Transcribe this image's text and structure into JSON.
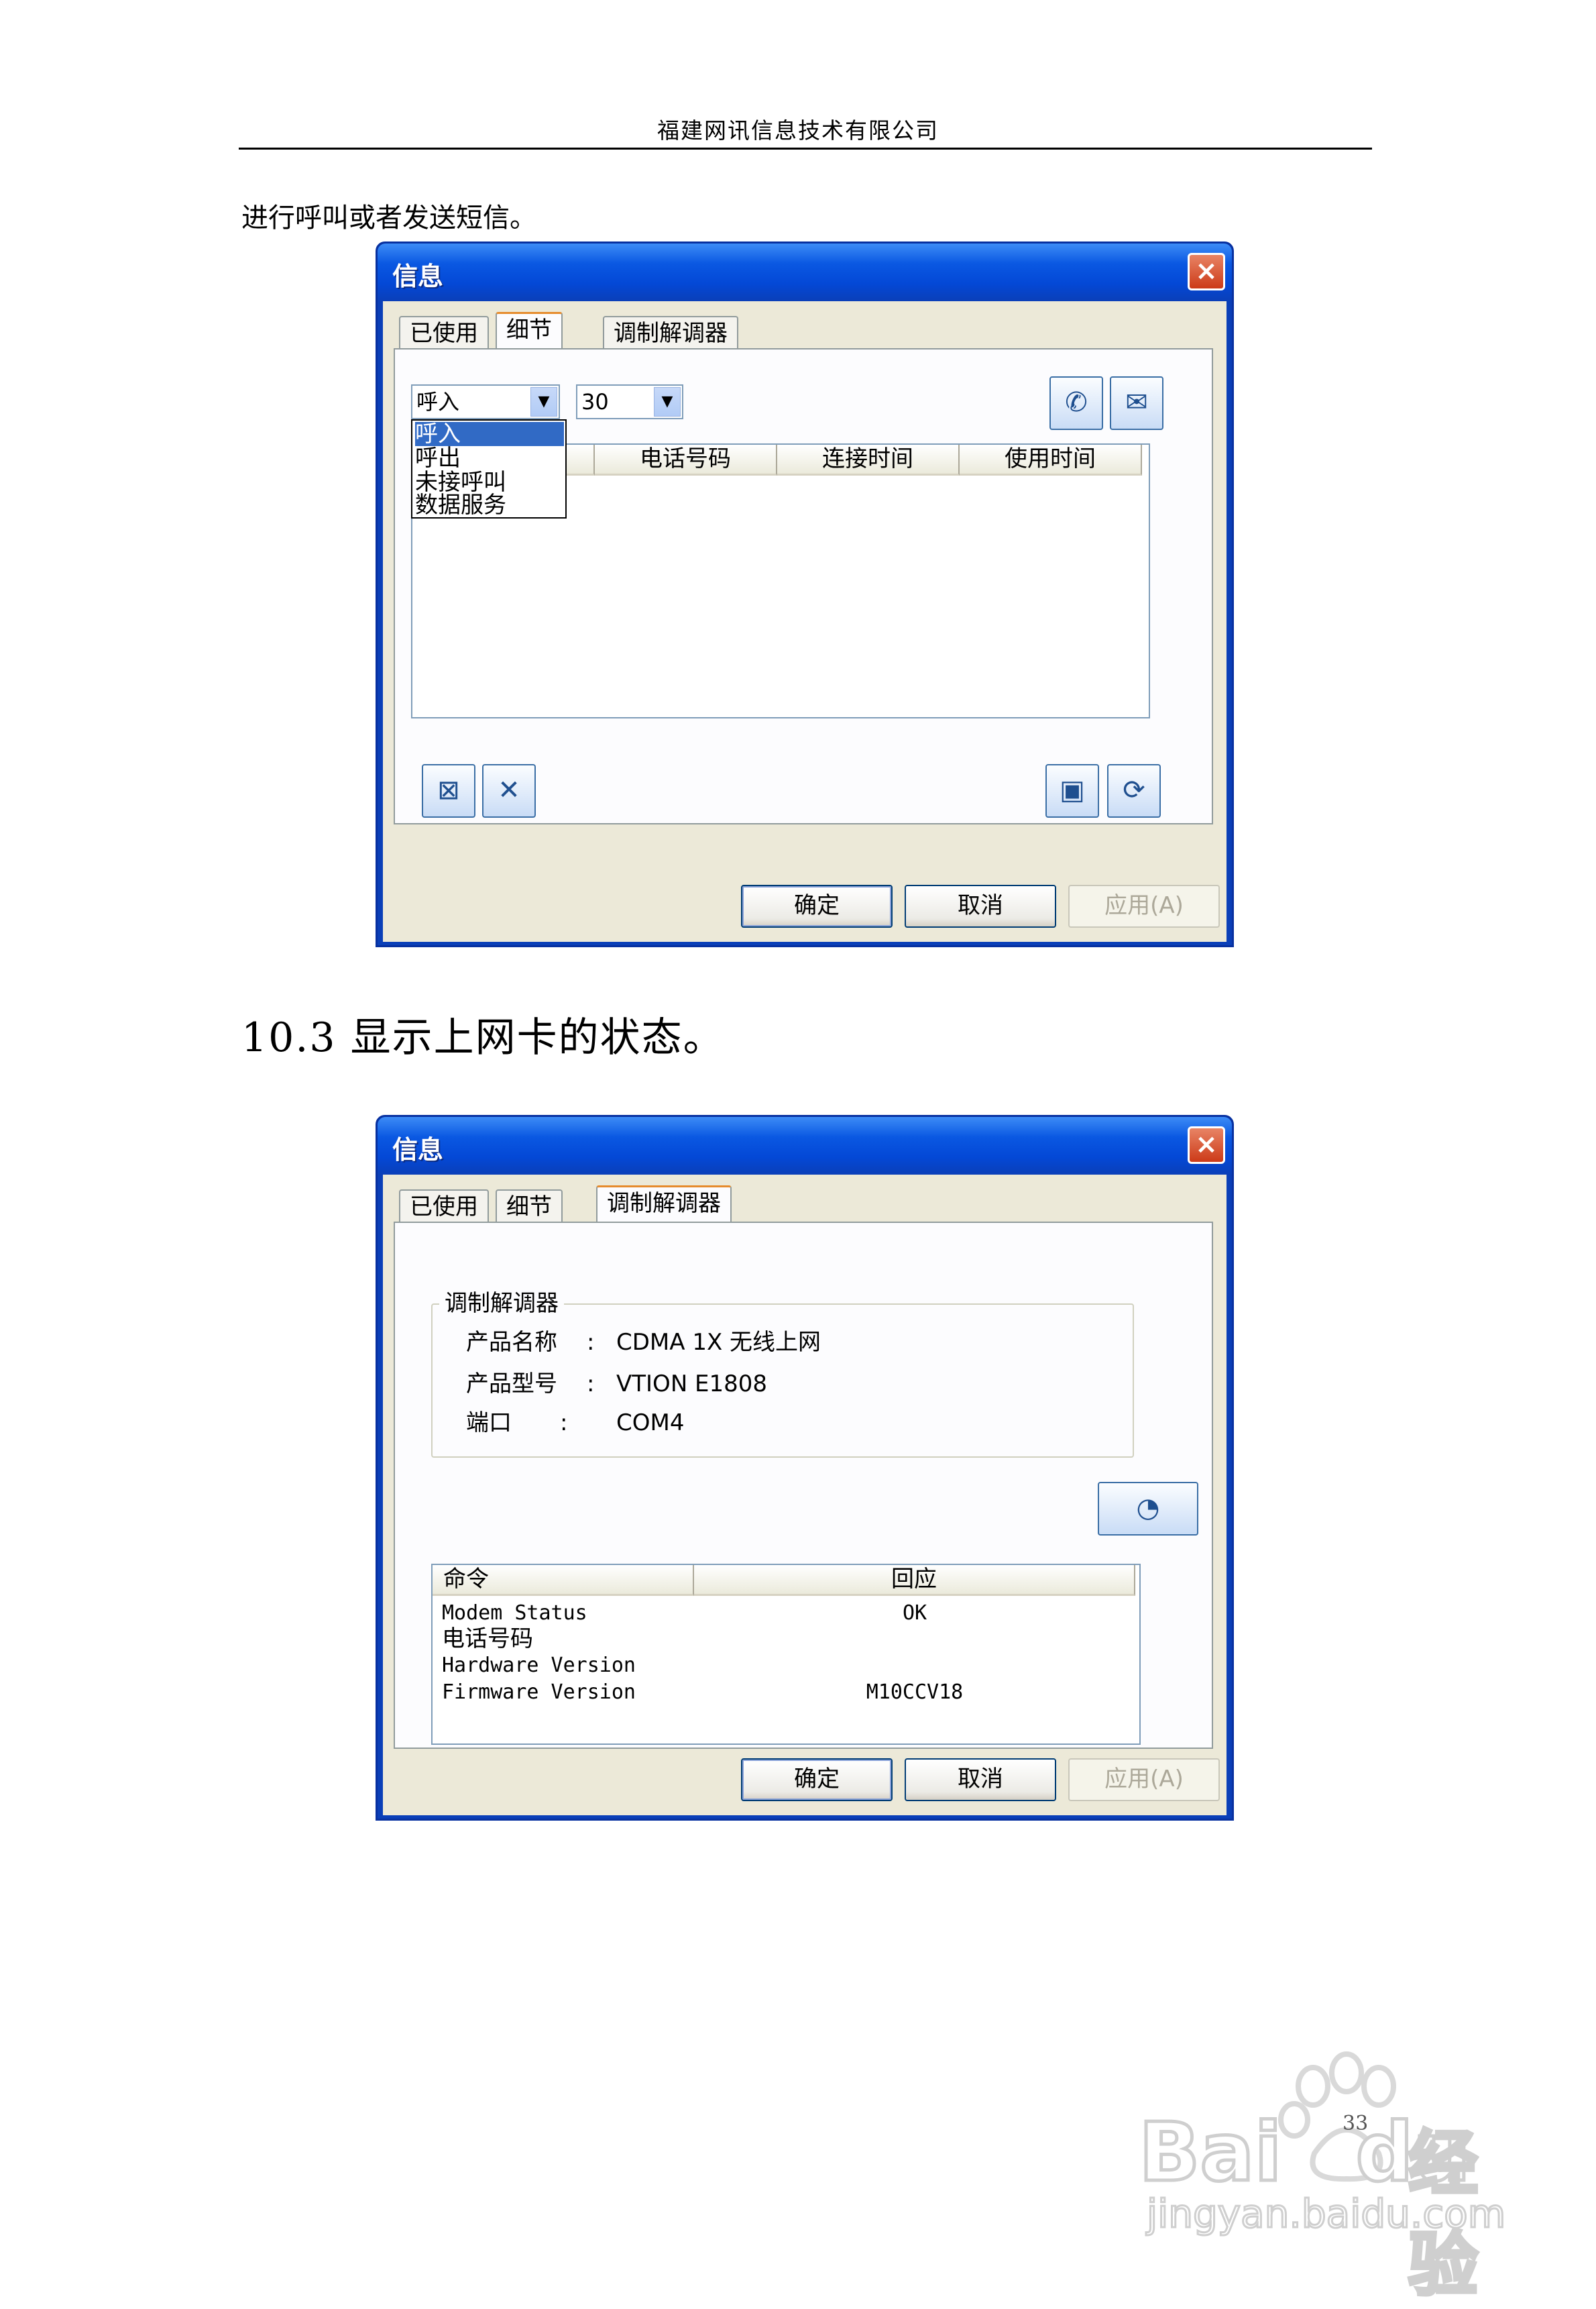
{
  "header": {
    "company": "福建网讯信息技术有限公司"
  },
  "intro_text": "进行呼叫或者发送短信。",
  "section_title": "10.3  显示上网卡的状态。",
  "dialog1": {
    "title": "信息",
    "tabs": [
      "已使用",
      "细节",
      "调制解调器"
    ],
    "active_tab": "细节",
    "type_combo": "呼入",
    "count_combo": "30",
    "dropdown_options": [
      "呼入",
      "呼出",
      "未接呼叫",
      "数据服务"
    ],
    "columns": [
      "电话号码",
      "连接时间",
      "使用时间"
    ],
    "buttons": {
      "ok": "确定",
      "cancel": "取消",
      "apply": "应用(A)"
    }
  },
  "dialog2": {
    "title": "信息",
    "tabs": [
      "已使用",
      "细节",
      "调制解调器"
    ],
    "active_tab": "调制解调器",
    "group_title": "调制解调器",
    "product_name_label": "产品名称",
    "product_name_value": "CDMA 1X 无线上网",
    "product_model_label": "产品型号",
    "product_model_value": "VTION E1808",
    "port_label": "端口",
    "port_value": "COM4",
    "colon": ":",
    "columns": [
      "命令",
      "回应"
    ],
    "rows": [
      {
        "command": "Modem Status",
        "response": "OK"
      },
      {
        "command": "电话号码",
        "response": ""
      },
      {
        "command": "Hardware Version",
        "response": ""
      },
      {
        "command": "Firmware Version",
        "response": "M10CCV18"
      }
    ],
    "buttons": {
      "ok": "确定",
      "cancel": "取消",
      "apply": "应用(A)"
    }
  },
  "watermark": {
    "brand": "Bai",
    "brand_tail": "du",
    "product": "经验",
    "url": "jingyan.baidu.com",
    "page_number": "33"
  },
  "icons": {
    "call": "phone-icon",
    "sms": "envelope-icon",
    "delete_all": "delete-all-icon",
    "delete": "delete-icon",
    "save": "save-icon",
    "refresh": "refresh-icon",
    "diagnose": "gauge-icon"
  },
  "colors": {
    "title_bar": "#0a58e2",
    "dialog_face": "#ece9d8",
    "selection": "#316ac5",
    "close": "#cc3a18"
  }
}
